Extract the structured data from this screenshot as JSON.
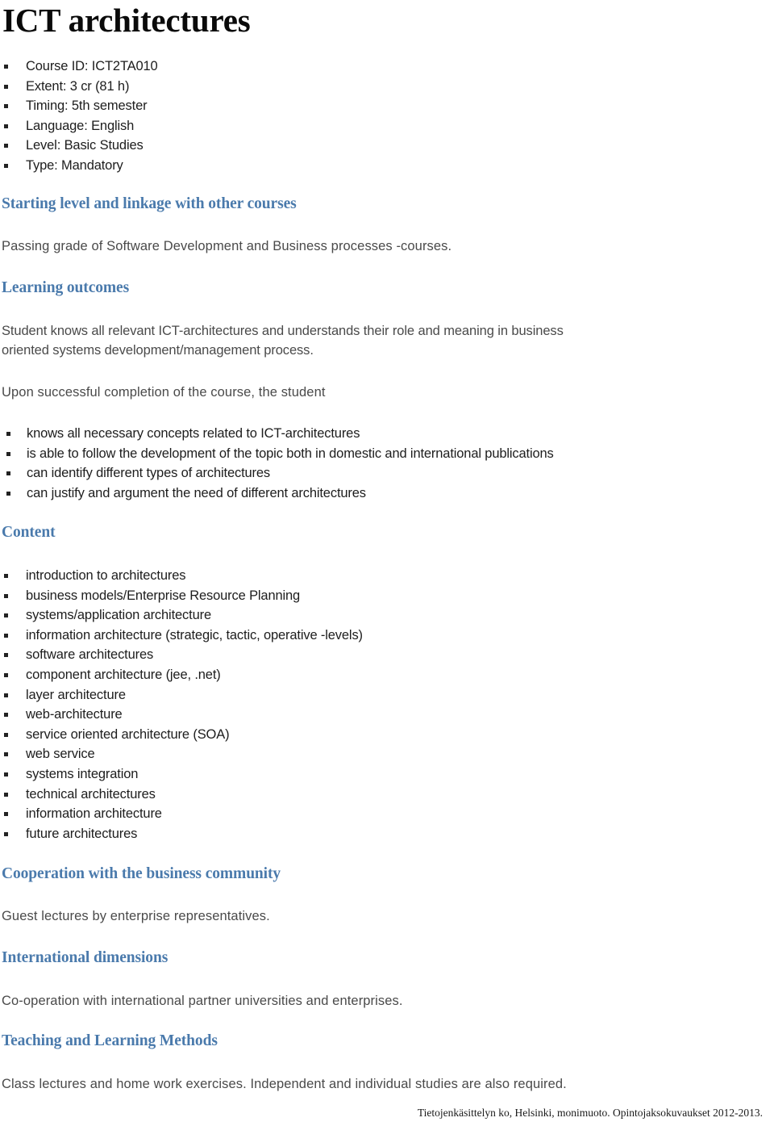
{
  "document": {
    "title": "ICT architectures",
    "footer": "Tietojenkäsittelyn ko, Helsinki, monimuoto. Opintojaksokuvaukset 2012-2013."
  },
  "colors": {
    "heading_blue": "#4a7aac",
    "title_black": "#0a0a0a",
    "body_grey": "#4a4a4a",
    "list_black": "#1d1d1d"
  },
  "meta_list": {
    "items": [
      "Course ID: ICT2TA010",
      "Extent: 3 cr (81 h)",
      "Timing: 5th semester",
      "Language: English",
      "Level: Basic Studies",
      "Type: Mandatory"
    ]
  },
  "sections": {
    "starting_level": {
      "heading": "Starting level and linkage with other courses",
      "paragraph": "Passing grade of Software Development and Business processes -courses."
    },
    "learning_outcomes": {
      "heading": "Learning outcomes",
      "paragraph_line1": "Student knows all relevant ICT-architectures and understands their role and meaning in business",
      "paragraph_line2": "oriented systems development/management process.",
      "lead_in": "Upon successful completion of the course, the student",
      "items": [
        "knows all necessary concepts related to ICT-architectures",
        "is able to follow the development of the topic both in domestic and international publications",
        "can identify different types of architectures",
        "can justify and argument the need of different architectures"
      ]
    },
    "content": {
      "heading": "Content",
      "items": [
        "introduction to architectures",
        "business models/Enterprise Resource Planning",
        "systems/application architecture",
        "information architecture (strategic, tactic, operative -levels)",
        "software architectures",
        "component architecture (jee, .net)",
        "layer architecture",
        "web-architecture",
        "service oriented architecture (SOA)",
        "web service",
        "systems integration",
        "technical architectures",
        "information architecture",
        "future architectures"
      ]
    },
    "cooperation": {
      "heading": "Cooperation with the business community",
      "paragraph": "Guest lectures by enterprise representatives."
    },
    "international": {
      "heading": "International dimensions",
      "paragraph": "Co-operation with international partner universities and enterprises."
    },
    "teaching": {
      "heading": "Teaching and Learning Methods",
      "paragraph": "Class lectures and home work exercises. Independent and individual studies are also required."
    }
  }
}
